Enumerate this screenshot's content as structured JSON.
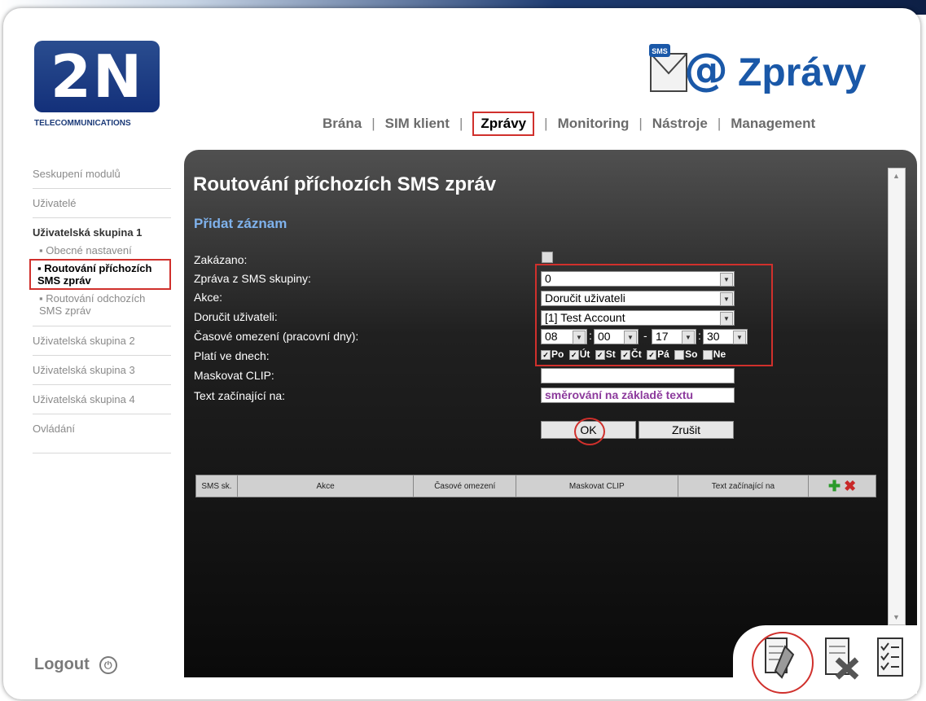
{
  "brand": {
    "logo_text": "2N",
    "logo_sub": "TELECOMMUNICATIONS"
  },
  "module": {
    "title": "Zprávy",
    "icon_badge": "SMS",
    "icon_symbol": "@"
  },
  "nav": {
    "items": [
      "Brána",
      "SIM klient",
      "Zprávy",
      "Monitoring",
      "Nástroje",
      "Management"
    ],
    "active": "Zprávy",
    "sep": "|"
  },
  "sidebar": {
    "items": [
      "Seskupení modulů",
      "Uživatelé"
    ],
    "group1": "Uživatelská skupina 1",
    "group1_sub": [
      "Obecné nastavení",
      "Routování příchozích SMS zpráv",
      "Routování odchozích SMS zpráv"
    ],
    "group2": "Uživatelská skupina 2",
    "group3": "Uživatelská skupina 3",
    "group4": "Uživatelská skupina 4",
    "ovladani": "Ovládání",
    "logout": "Logout"
  },
  "page": {
    "title": "Routování příchozích SMS zpráv",
    "section": "Přidat záznam"
  },
  "form": {
    "labels": {
      "disabled": "Zakázano:",
      "from_group": "Zpráva z SMS skupiny:",
      "action": "Akce:",
      "deliver_user": "Doručit uživateli:",
      "time_limit": "Časové omezení (pracovní dny):",
      "valid_days": "Platí ve dnech:",
      "mask_clip": "Maskovat CLIP:",
      "text_starts": "Text začínající na:"
    },
    "values": {
      "from_group": "0",
      "action": "Doručit uživateli",
      "deliver_user": "[1] Test Account",
      "time_from_h": "08",
      "time_from_m": "00",
      "time_to_h": "17",
      "time_to_m": "30",
      "time_sep": "-",
      "time_colon": ":",
      "mask_clip": "",
      "text_starts": "směrování na základě textu"
    },
    "days": [
      {
        "label": "Po",
        "checked": true
      },
      {
        "label": "Út",
        "checked": true
      },
      {
        "label": "St",
        "checked": true
      },
      {
        "label": "Čt",
        "checked": true
      },
      {
        "label": "Pá",
        "checked": true
      },
      {
        "label": "So",
        "checked": false
      },
      {
        "label": "Ne",
        "checked": false
      }
    ],
    "ok": "OK",
    "cancel": "Zrušit"
  },
  "table": {
    "headers": [
      "SMS sk.",
      "Akce",
      "Časové omezení",
      "Maskovat CLIP",
      "Text začínající na"
    ]
  },
  "colors": {
    "accent": "#1a58a8",
    "highlight": "#d0302c",
    "section": "#7fb2ec"
  }
}
